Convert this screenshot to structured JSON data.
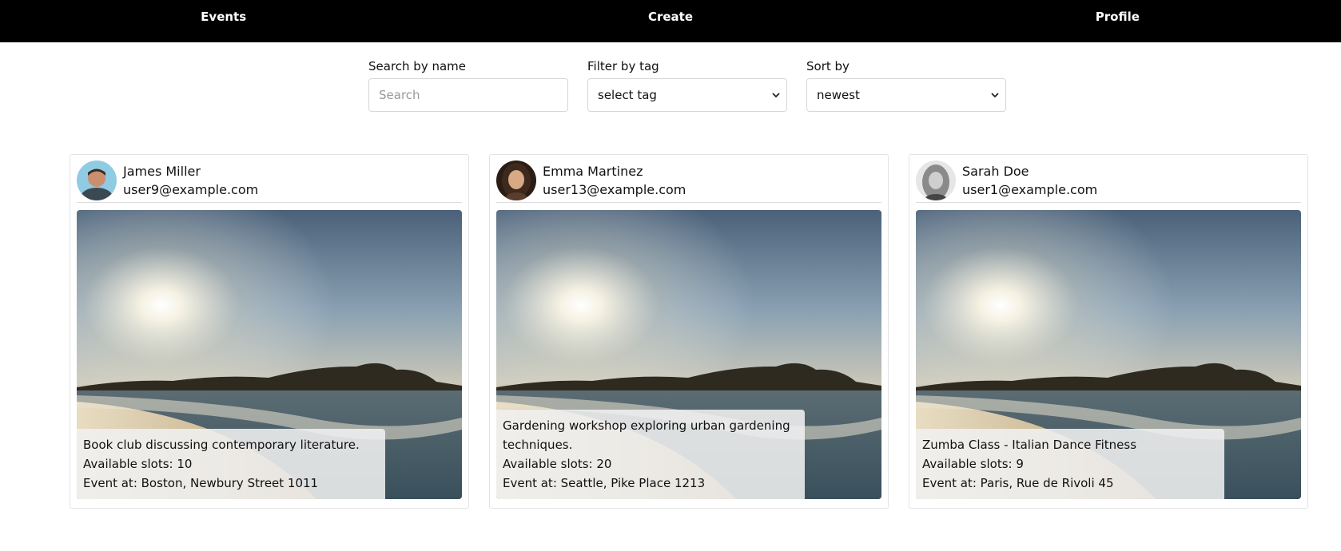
{
  "nav": {
    "events": "Events",
    "create": "Create",
    "profile": "Profile"
  },
  "filters": {
    "search_label": "Search by name",
    "search_placeholder": "Search",
    "search_value": "",
    "tag_label": "Filter by tag",
    "tag_selected": "select tag",
    "sort_label": "Sort by",
    "sort_selected": "newest"
  },
  "cards": [
    {
      "name": "James Miller",
      "email": "user9@example.com",
      "description": "Book club discussing contemporary literature.",
      "slots": "Available slots: 10",
      "location": "Event at: Boston, Newbury Street 1011"
    },
    {
      "name": "Emma Martinez",
      "email": "user13@example.com",
      "description": "Gardening workshop exploring urban gardening techniques.",
      "slots": "Available slots: 20",
      "location": "Event at: Seattle, Pike Place 1213"
    },
    {
      "name": "Sarah Doe",
      "email": "user1@example.com",
      "description": "Zumba Class - Italian Dance Fitness",
      "slots": "Available slots: 9",
      "location": "Event at: Paris, Rue de Rivoli 45"
    }
  ],
  "colors": {
    "navbar_bg": "#000000",
    "navbar_text": "#ffffff",
    "card_border": "#e3e3e3",
    "overlay": "#f0f0f0"
  }
}
